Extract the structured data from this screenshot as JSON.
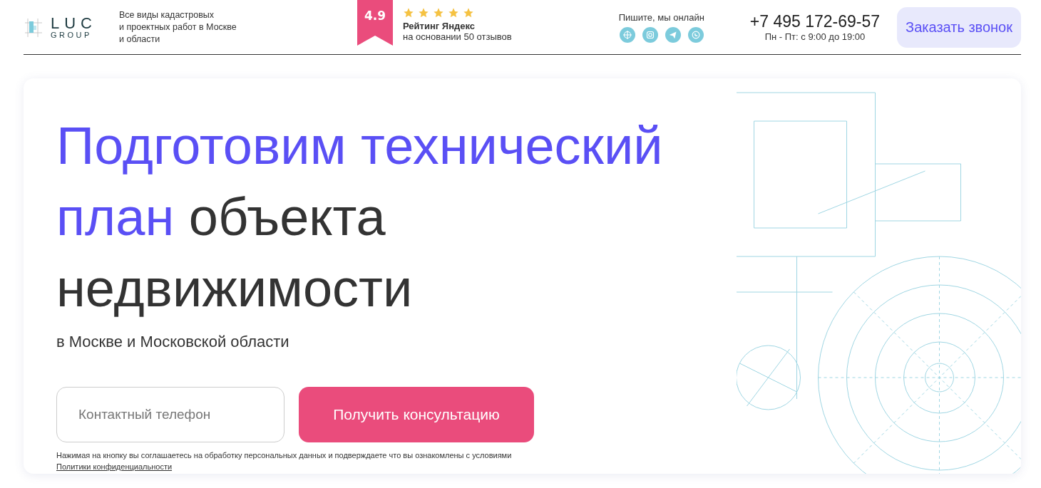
{
  "header": {
    "logo": {
      "name": "LUC",
      "sub": "GROUP"
    },
    "tagline": "Все виды кадастровых\nи проектных работ в Москве\nи области",
    "rating": {
      "score": "4.9",
      "stars": 5,
      "title": "Рейтинг Яндекс",
      "note": "на основании 50 отзывов"
    },
    "contact": {
      "label": "Пишите, мы онлайн",
      "channels": [
        {
          "kind": "compass"
        },
        {
          "kind": "camera"
        },
        {
          "kind": "plane"
        },
        {
          "kind": "phone"
        }
      ]
    },
    "phone": {
      "number": "+7 495 172-69-57",
      "hours": "Пн - Пт: с 9:00 до 19:00"
    },
    "callback": "Заказать звонок"
  },
  "hero": {
    "headline": {
      "highlight": "Подготовим технический план",
      "rest": "объекта недвижимости"
    },
    "subtitle": "в Москве и Московской области",
    "phone_field": {
      "placeholder": "Контактный телефон"
    },
    "submit": "Получить консультацию",
    "consent": {
      "text": "Нажимая на кнопку вы соглашаетесь на обработку персональных данных и подверждаете что вы ознакомлены с условиями",
      "link": "Политики конфиденциальности"
    }
  }
}
